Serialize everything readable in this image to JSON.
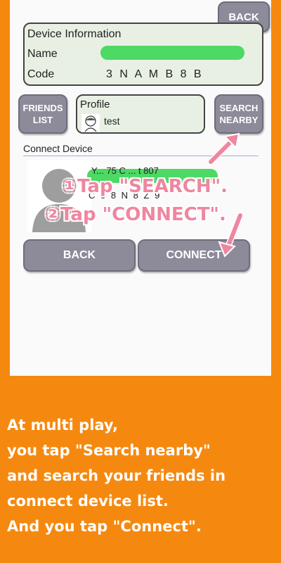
{
  "top_back_button": "BACK",
  "device_info": {
    "title": "Device Information",
    "name_label": "Name",
    "code_label": "Code",
    "code_value": "3 N A M B 8 B"
  },
  "friends_list_button": "FRIENDS\nLIST",
  "profile": {
    "label": "Profile",
    "name": "test"
  },
  "search_nearby_button": "SEARCH\nNEARBY",
  "connect_device": {
    "label": "Connect Device",
    "item_line1": "Y... 75 C ... t 807",
    "item_line2": "C 0 8 N 8 Z 9"
  },
  "overlay_instructions": {
    "step1": "①Tap \"SEARCH\".",
    "step2": "②Tap \"CONNECT\"."
  },
  "bottom_buttons": {
    "back": "BACK",
    "connect": "CONNECT"
  },
  "caption_lines": [
    "At multi play,",
    "you tap \"Search nearby\"",
    "and search your friends in",
    "connect device list.",
    "And you tap \"Connect\"."
  ],
  "colors": {
    "background": "#f5890f",
    "button_gray": "#8d8a9a",
    "green": "#4cd964",
    "overlay_pink": "#ef86a0",
    "info_box": "#e8f0e3"
  }
}
